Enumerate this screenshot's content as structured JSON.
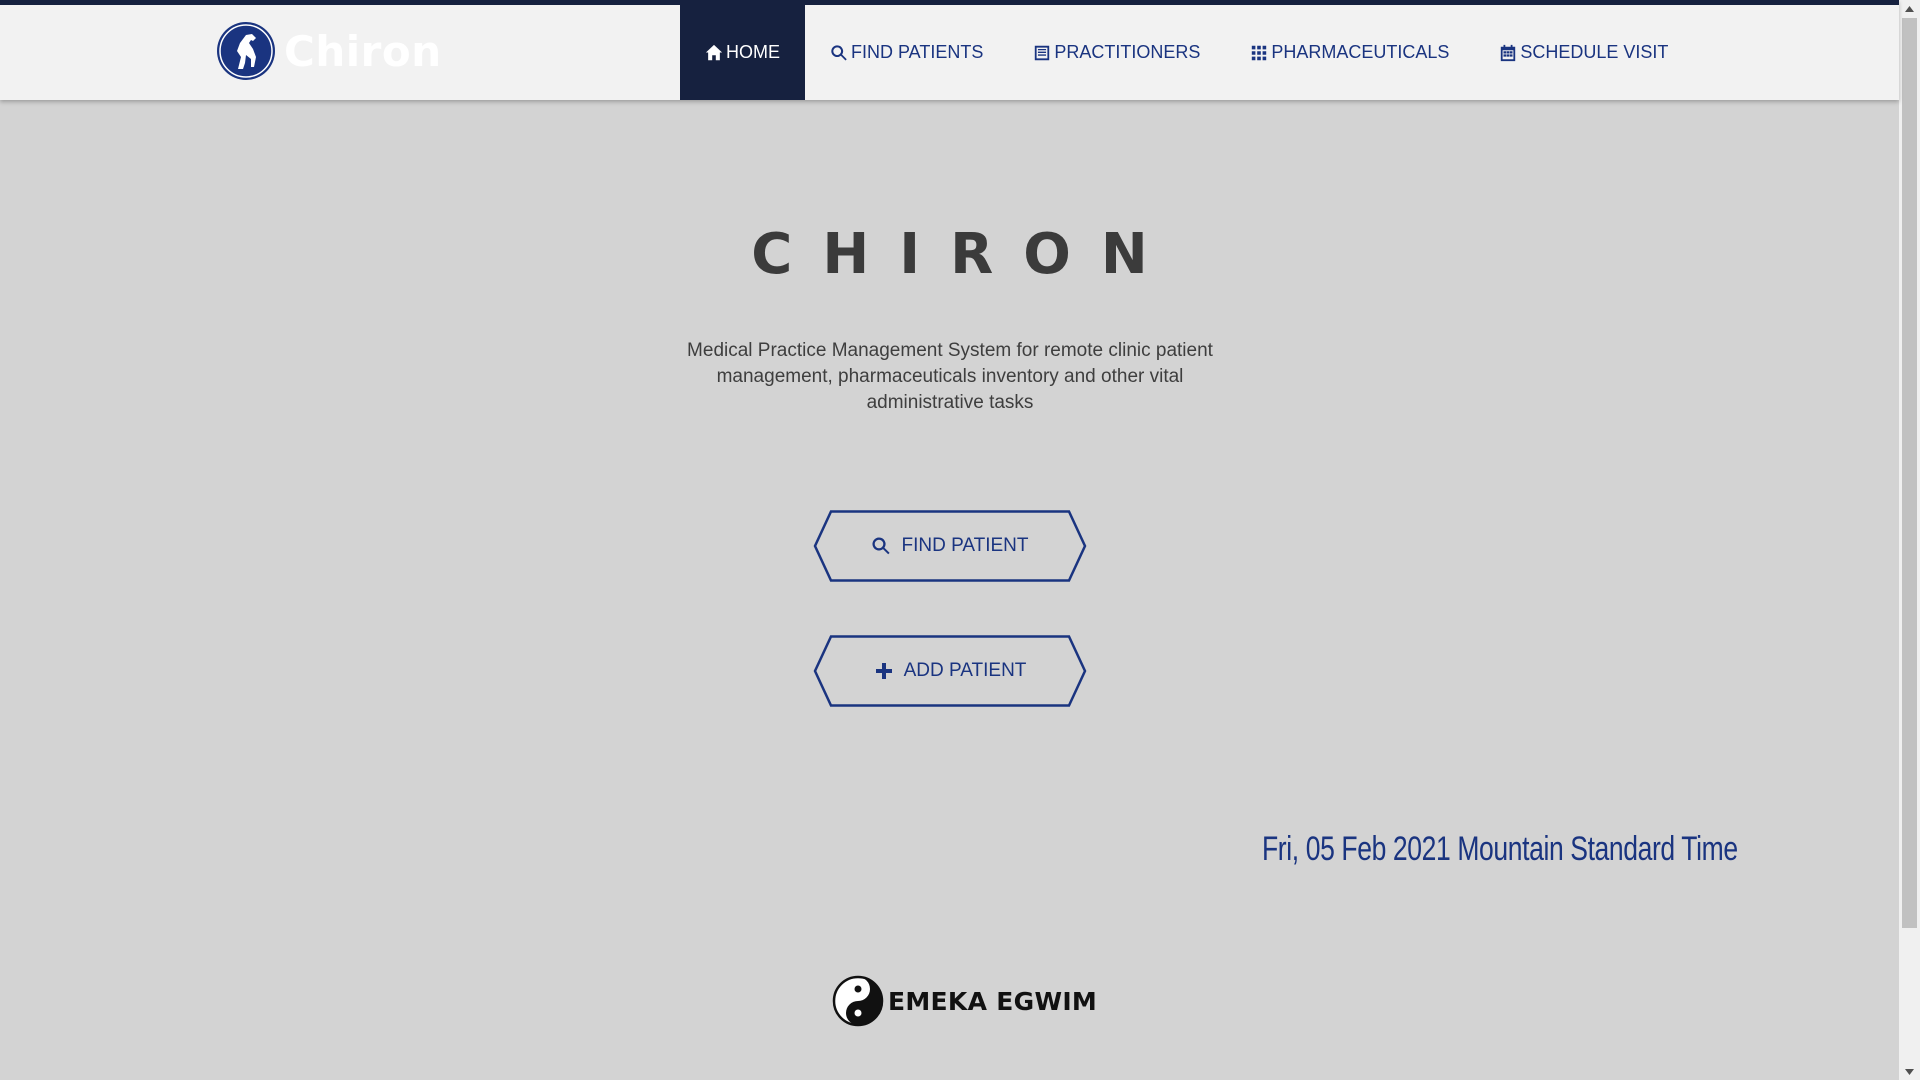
{
  "brand": {
    "name": "Chiron",
    "logo_icon": "horse-logo-icon"
  },
  "nav": {
    "items": [
      {
        "label": "HOME",
        "icon": "home-icon",
        "active": true
      },
      {
        "label": "FIND PATIENTS",
        "icon": "search-icon",
        "active": false
      },
      {
        "label": "PRACTITIONERS",
        "icon": "list-icon",
        "active": false
      },
      {
        "label": "PHARMACEUTICALS",
        "icon": "grid-icon",
        "active": false
      },
      {
        "label": "SCHEDULE VISIT",
        "icon": "calendar-icon",
        "active": false
      }
    ]
  },
  "hero": {
    "title": "CHIRON",
    "description": "Medical Practice Management System for remote clinic patient management, pharmaceuticals inventory and other vital administrative tasks"
  },
  "actions": {
    "find_patient_label": "FIND PATIENT",
    "add_patient_label": "ADD PATIENT"
  },
  "date_display": "Fri, 05 Feb 2021 Mountain Standard Time",
  "footer": {
    "author": "EMEKA EGWIM",
    "logo_icon": "yin-yang-icon"
  },
  "colors": {
    "accent": "#1a3480",
    "nav_active_bg": "#16213f",
    "page_bg": "#d3d3d3",
    "topbar_bg": "#f2f2f2"
  }
}
